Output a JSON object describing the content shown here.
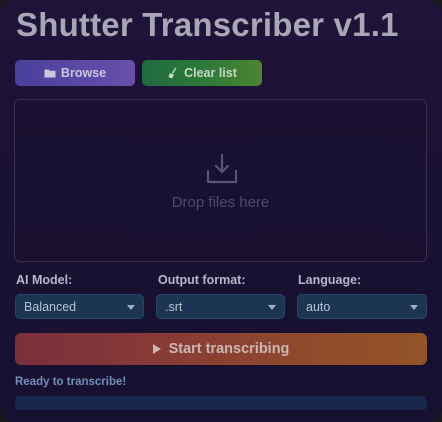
{
  "app": {
    "title": "Shutter Transcriber v1.1"
  },
  "toolbar": {
    "browse_label": "Browse",
    "browse_icon": "folder-icon",
    "clear_label": "Clear list",
    "clear_icon": "broom-icon"
  },
  "dropzone": {
    "icon": "download-icon",
    "text": "Drop files here"
  },
  "settings": {
    "model": {
      "label": "AI Model:",
      "value": "Balanced"
    },
    "format": {
      "label": "Output format:",
      "value": ".srt"
    },
    "language": {
      "label": "Language:",
      "value": "auto"
    }
  },
  "start": {
    "label": "Start transcribing",
    "icon": "play-icon"
  },
  "status": {
    "text": "Ready to transcribe!",
    "progress": 0
  },
  "colors": {
    "background": "#1f1339",
    "browse_button": "#5c4aa6",
    "clear_button": "#2e7a3a",
    "select_bg": "#1b3552",
    "start_button_from": "#7a2f3d",
    "start_button_to": "#935426",
    "status_text": "#6f8fb8",
    "progress_track": "#172649"
  }
}
